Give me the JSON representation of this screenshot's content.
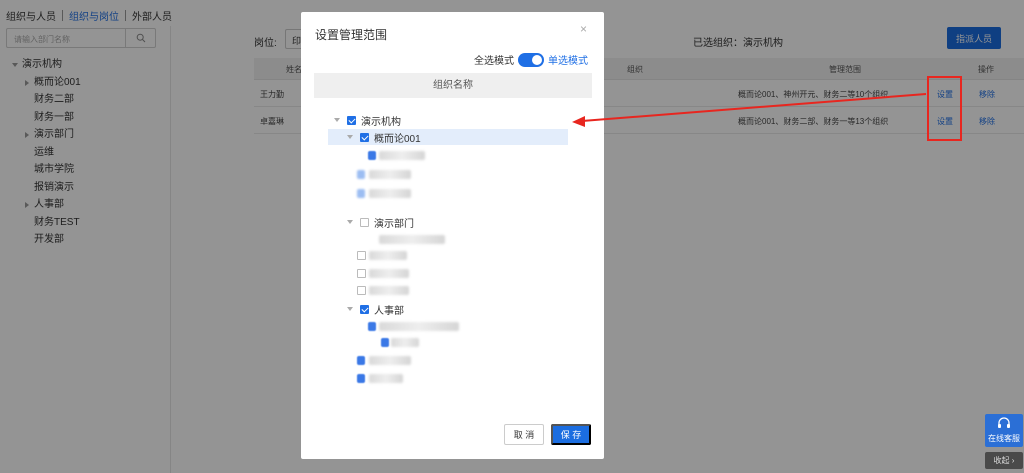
{
  "topnav": {
    "tabs": [
      "组织与人员",
      "组织与岗位",
      "外部人员"
    ],
    "active": 1
  },
  "sidebar": {
    "search_placeholder": "请输入部门名称",
    "tree": [
      {
        "label": "演示机构",
        "arrow": "down",
        "level": 0
      },
      {
        "label": "概而论001",
        "arrow": "right",
        "level": 1
      },
      {
        "label": "财务二部",
        "arrow": "",
        "level": 1
      },
      {
        "label": "财务一部",
        "arrow": "",
        "level": 1
      },
      {
        "label": "演示部门",
        "arrow": "right",
        "level": 1
      },
      {
        "label": "运维",
        "arrow": "",
        "level": 1
      },
      {
        "label": "城市学院",
        "arrow": "",
        "level": 1
      },
      {
        "label": "报销演示",
        "arrow": "",
        "level": 1
      },
      {
        "label": "人事部",
        "arrow": "right",
        "level": 1
      },
      {
        "label": "财务TEST",
        "arrow": "",
        "level": 1
      },
      {
        "label": "开发部",
        "arrow": "",
        "level": 1
      }
    ]
  },
  "main": {
    "position_label": "岗位:",
    "position_value": "印",
    "selected_org": "已选组织：演示机构",
    "assign_button": "指派人员",
    "table": {
      "headers": {
        "name": "姓名",
        "org": "组织",
        "scope": "管理范围",
        "ops": "操作"
      },
      "rows": [
        {
          "name": "王力勤",
          "scope": "概而论001、神州开元、财务二等10个组织",
          "set": "设置",
          "remove": "移除"
        },
        {
          "name": "卓嘉琳",
          "scope": "概而论001、财务二部、财务一等13个组织",
          "set": "设置",
          "remove": "移除"
        }
      ]
    }
  },
  "modal": {
    "title": "设置管理范围",
    "close": "×",
    "mode_all": "全选模式",
    "mode_single": "单选模式",
    "column_header": "组织名称",
    "tree": {
      "root": "演示机构",
      "n1": "概而论001",
      "n2": "演示部门",
      "n3": "人事部"
    },
    "cancel": "取 消",
    "save": "保 存"
  },
  "float": {
    "service_label": "在线客服",
    "collapse_label": "收起"
  },
  "colors": {
    "primary": "#1f6fe5",
    "annotation_red": "#e8261f"
  }
}
